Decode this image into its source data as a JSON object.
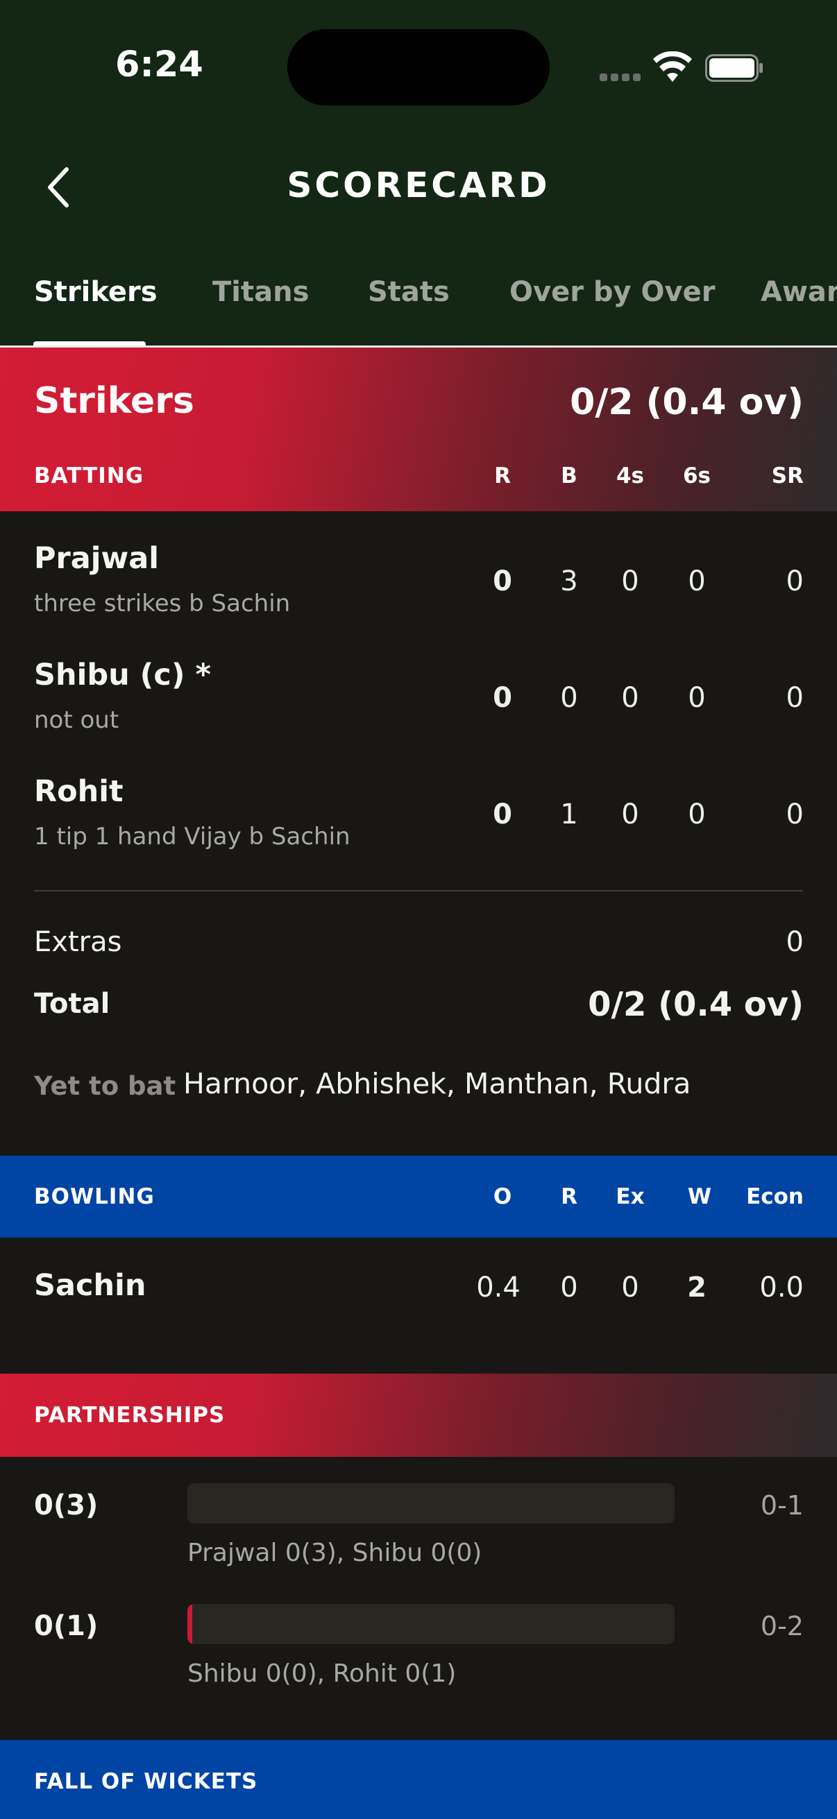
{
  "status_bar": {
    "time": "6:24"
  },
  "header": {
    "title": "SCORECARD"
  },
  "tabs": [
    {
      "label": "Strikers",
      "active": true
    },
    {
      "label": "Titans",
      "active": false
    },
    {
      "label": "Stats",
      "active": false
    },
    {
      "label": "Over by Over",
      "active": false
    },
    {
      "label": "Awards",
      "active": false
    }
  ],
  "innings": {
    "team": "Strikers",
    "score": "0/2 (0.4 ov)"
  },
  "batting": {
    "label": "BATTING",
    "columns": [
      "R",
      "B",
      "4s",
      "6s",
      "SR"
    ],
    "rows": [
      {
        "name": "Prajwal",
        "dismissal": "three strikes b Sachin",
        "r": "0",
        "b": "3",
        "fours": "0",
        "sixes": "0",
        "sr": "0"
      },
      {
        "name": "Shibu (c) *",
        "dismissal": "not out",
        "r": "0",
        "b": "0",
        "fours": "0",
        "sixes": "0",
        "sr": "0"
      },
      {
        "name": "Rohit",
        "dismissal": "1 tip 1 hand Vijay b Sachin",
        "r": "0",
        "b": "1",
        "fours": "0",
        "sixes": "0",
        "sr": "0"
      }
    ],
    "extras_label": "Extras",
    "extras_value": "0",
    "total_label": "Total",
    "total_value": "0/2 (0.4 ov)",
    "yet_to_bat_label": "Yet to bat",
    "yet_to_bat": "Harnoor, Abhishek, Manthan, Rudra"
  },
  "bowling": {
    "label": "BOWLING",
    "columns": [
      "O",
      "R",
      "Ex",
      "W",
      "Econ"
    ],
    "rows": [
      {
        "name": "Sachin",
        "o": "0.4",
        "r": "0",
        "ex": "0",
        "w": "2",
        "econ": "0.0"
      }
    ]
  },
  "partnerships": {
    "label": "PARTNERSHIPS",
    "rows": [
      {
        "runs": "0(3)",
        "players": "Prajwal 0(3), Shibu 0(0)",
        "wicket": "0-1",
        "fill_fraction": 0.0
      },
      {
        "runs": "0(1)",
        "players": "Shibu 0(0), Rohit 0(1)",
        "wicket": "0-2",
        "fill_fraction": 0.01
      }
    ]
  },
  "fall_of_wickets": {
    "label": "FALL OF WICKETS"
  },
  "colors": {
    "header_bg": "#132714",
    "page_bg": "#181715",
    "accent_red": "#d31c35",
    "accent_blue": "#0044a4"
  }
}
